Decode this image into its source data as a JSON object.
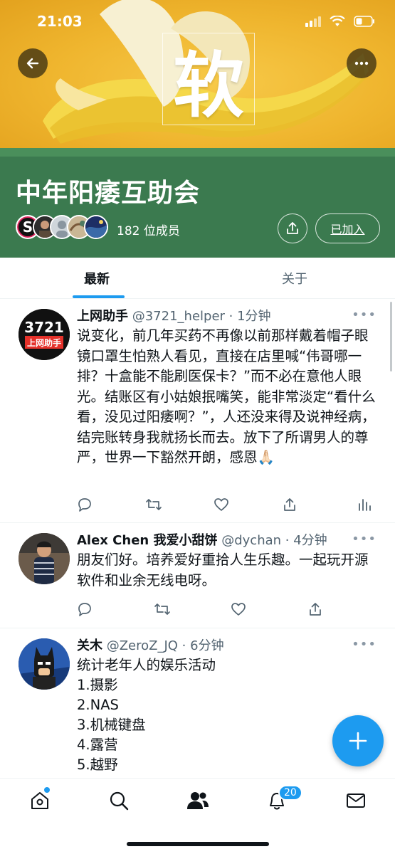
{
  "status_bar": {
    "time": "21:03"
  },
  "banner": {
    "big_character": "软"
  },
  "community": {
    "title": "中年阳痿互助会",
    "member_count": "182 位成员",
    "joined_label": "已加入"
  },
  "tabs": [
    {
      "label": "最新",
      "active": true
    },
    {
      "label": "关于",
      "active": false
    }
  ],
  "posts": [
    {
      "avatar_text_top": "3721",
      "avatar_text_bottom": "上网助手",
      "name": "上网助手",
      "meta": " @3721_helper · 1分钟",
      "body": "说变化，前几年买药不再像以前那样戴着帽子眼镜口罩生怕熟人看见，直接在店里喊“伟哥哪一排？十盒能不能刷医保卡？”而不必在意他人眼光。结账区有小姑娘抿嘴笑，能非常淡定“看什么看，没见过阳痿啊？”，人还没来得及说神经病，结完账转身我就扬长而去。放下了所谓男人的尊严，世界一下豁然开朗，感恩🙏🏻"
    },
    {
      "name": "Alex Chen 我爱小甜饼",
      "meta": " @dychan · 4分钟",
      "body": "朋友们好。培养爱好重拾人生乐趣。一起玩开源软件和业余无线电呀。"
    },
    {
      "name": "关木",
      "meta": " @ZeroZ_JQ · 6分钟",
      "body": "统计老年人的娱乐活动\n1.摄影\n2.NAS\n3.机械键盘\n4.露营\n5.越野"
    }
  ],
  "nav": {
    "notification_badge": "20"
  },
  "colors": {
    "accent": "#1d9bf0",
    "header_green": "#3b7a4f",
    "banner_yellow": "#efb52e"
  }
}
